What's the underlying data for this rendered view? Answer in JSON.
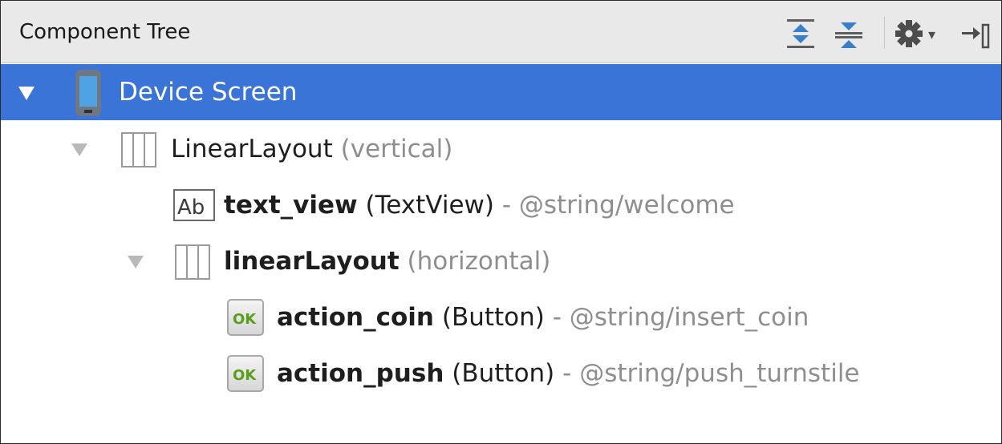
{
  "panel": {
    "title": "Component Tree",
    "toolbar": {
      "expand_icon": "expand-all-icon",
      "collapse_icon": "collapse-all-icon",
      "settings_icon": "gear-icon",
      "settings_arrow": "▾",
      "hide_icon": "hide-panel-icon"
    }
  },
  "tree": {
    "rows": [
      {
        "label": "Device Screen",
        "icon": "device-icon",
        "expanded": true,
        "selected": true
      },
      {
        "label": "LinearLayout",
        "detail": "(vertical)",
        "icon": "linear-layout-icon",
        "expanded": true
      },
      {
        "id": "text_view",
        "type": "(TextView)",
        "sep": "-",
        "value": "@string/welcome",
        "icon": "textview-icon"
      },
      {
        "id": "linearLayout",
        "detail": "(horizontal)",
        "icon": "linear-layout-icon",
        "expanded": true
      },
      {
        "id": "action_coin",
        "type": "(Button)",
        "sep": "-",
        "value": "@string/insert_coin",
        "icon": "button-icon",
        "icon_text": "OK"
      },
      {
        "id": "action_push",
        "type": "(Button)",
        "sep": "-",
        "value": "@string/push_turnstile",
        "icon": "button-icon",
        "icon_text": "OK"
      }
    ]
  },
  "colors": {
    "selection": "#3a74d6",
    "header_bg": "#e9e9e9",
    "muted_text": "#8e8e8e",
    "toolbar_blue": "#3c7fc9",
    "button_icon_green": "#5a9e1e"
  }
}
